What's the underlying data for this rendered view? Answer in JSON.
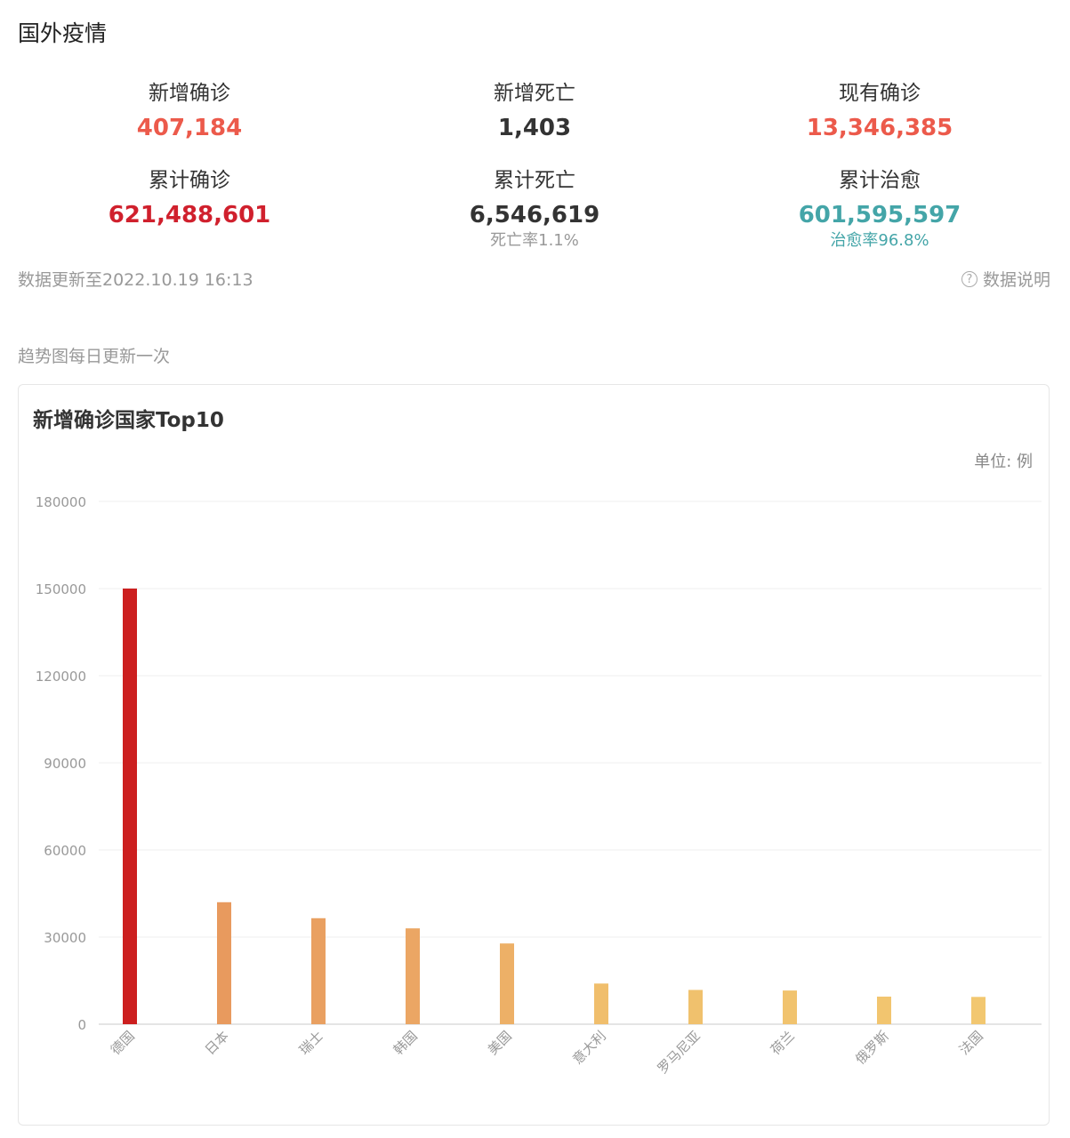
{
  "section_title": "国外疫情",
  "stats": [
    {
      "label": "新增确诊",
      "value": "407,184",
      "color": "#ec5a4b",
      "sub": ""
    },
    {
      "label": "新增死亡",
      "value": "1,403",
      "color": "#333333",
      "sub": ""
    },
    {
      "label": "现有确诊",
      "value": "13,346,385",
      "color": "#ec5a4b",
      "sub": ""
    },
    {
      "label": "累计确诊",
      "value": "621,488,601",
      "color": "#d0202d",
      "sub": ""
    },
    {
      "label": "累计死亡",
      "value": "6,546,619",
      "color": "#333333",
      "sub": "死亡率1.1%"
    },
    {
      "label": "累计治愈",
      "value": "601,595,597",
      "color": "#44a5a8",
      "sub": "治愈率96.8%"
    }
  ],
  "update_time": "数据更新至2022.10.19 16:13",
  "data_note": "数据说明",
  "trend_note": "趋势图每日更新一次",
  "chart_data": {
    "type": "bar",
    "title": "新增确诊国家Top10",
    "unit": "单位: 例",
    "categories": [
      "德国",
      "日本",
      "瑞士",
      "韩国",
      "美国",
      "意大利",
      "罗马尼亚",
      "荷兰",
      "俄罗斯",
      "法国"
    ],
    "values": [
      150000,
      42000,
      36500,
      33000,
      27800,
      14000,
      11800,
      11600,
      9500,
      9400
    ],
    "bar_colors": [
      "#cc1f1f",
      "#e89a5e",
      "#e9a061",
      "#eba664",
      "#edb067",
      "#f0be6c",
      "#f0c16d",
      "#f1c36e",
      "#f2c56f",
      "#f2c770"
    ],
    "yticks": [
      "0",
      "30000",
      "60000",
      "90000",
      "120000",
      "150000",
      "180000"
    ],
    "ylim": [
      0,
      180000
    ],
    "grid": true,
    "legend": "none"
  }
}
